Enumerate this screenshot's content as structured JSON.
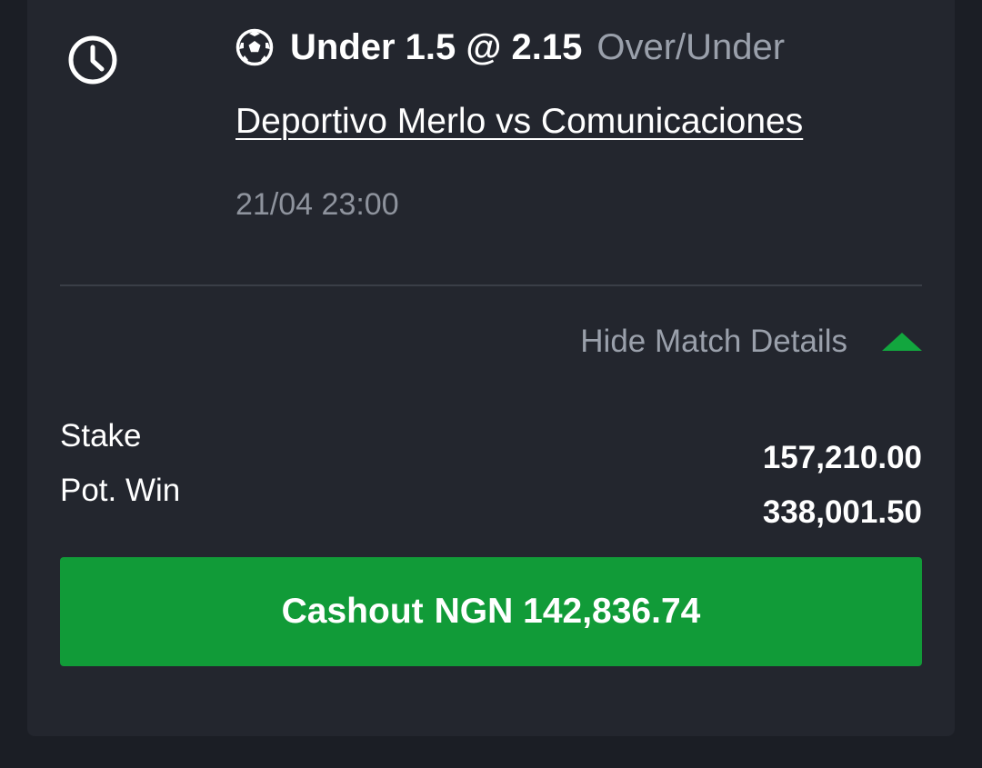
{
  "selection": {
    "pick": "Under 1.5 @ 2.15",
    "market": "Over/Under",
    "sport_icon": "soccer-ball-icon",
    "status_icon": "clock-icon"
  },
  "match": {
    "name": "Deportivo Merlo vs Comunicaciones",
    "datetime": "21/04 23:00"
  },
  "details_toggle": {
    "label": "Hide Match Details",
    "icon": "triangle-up-icon"
  },
  "bet": {
    "stake_label": "Stake",
    "stake_value": "157,210.00",
    "potwin_label": "Pot. Win",
    "potwin_value": "338,001.50"
  },
  "cashout": {
    "label": "Cashout",
    "amount": "NGN 142,836.74"
  },
  "colors": {
    "background": "#1b1e25",
    "card": "#23262e",
    "accent_green": "#119b38",
    "muted_text": "#9aa0ab"
  }
}
